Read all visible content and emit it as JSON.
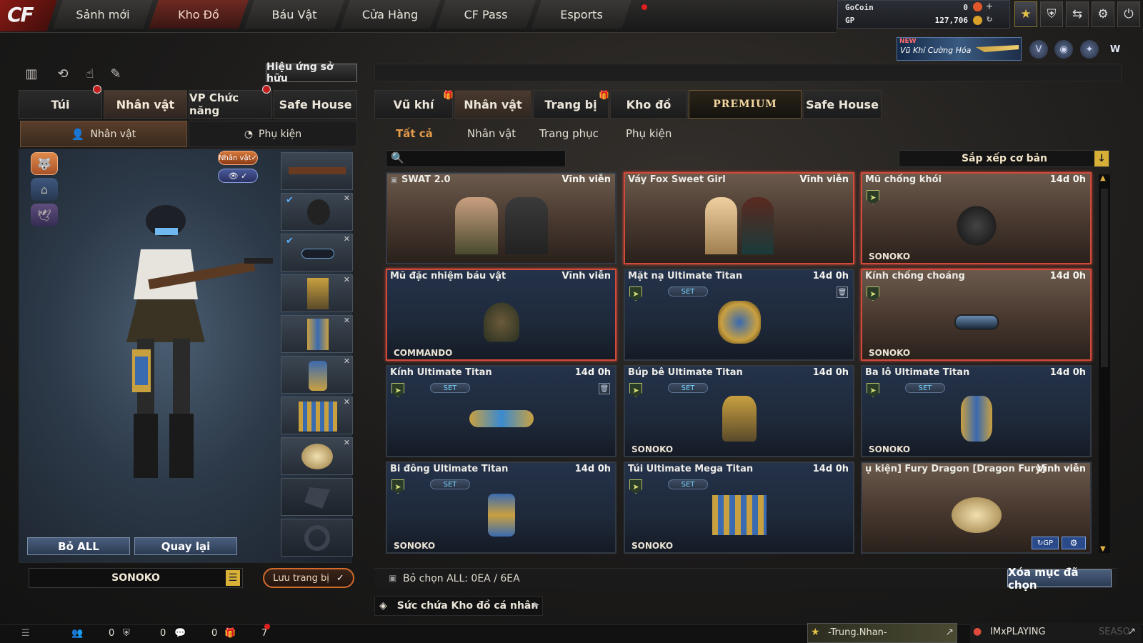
{
  "logo_text": "CF",
  "nav": {
    "tabs": [
      "Sảnh mới",
      "Kho Đồ",
      "Báu Vật",
      "Cửa Hàng",
      "CF Pass",
      "Esports"
    ],
    "active": "Kho Đồ"
  },
  "currency": {
    "gocoin_label": "GoCoin",
    "gocoin_value": "0",
    "gp_label": "GP",
    "gp_value": "127,706"
  },
  "top_icons": [
    "star-icon",
    "shield-icon",
    "exit-icon",
    "gear-icon",
    "power-icon"
  ],
  "banner": {
    "new_label": "NEW",
    "text": "Vũ Khí Cường Hóa"
  },
  "left": {
    "effect_button": "Hiệu ứng sở hữu",
    "tabs": [
      "Túi",
      "Nhân vật",
      "VP Chức năng",
      "Safe House"
    ],
    "active_tab": "Nhân vật",
    "subtabs": [
      "Nhân vật",
      "Phụ kiện"
    ],
    "active_subtab": "Nhân vật",
    "char_toggle": "Nhân vật",
    "btn_remove_all": "Bỏ ALL",
    "btn_back": "Quay lại",
    "character_name": "SONOKO",
    "save_button": "Lưu trang bị"
  },
  "right": {
    "tabs": [
      "Vũ khí",
      "Nhân vật",
      "Trang bị",
      "Kho đồ",
      "PREMIUM",
      "Safe House"
    ],
    "active_tab": "Nhân vật",
    "subtabs": [
      "Tất cả",
      "Nhân vật",
      "Trang phục",
      "Phụ kiện"
    ],
    "active_subtab": "Tất cả",
    "sort_label": "Sắp xếp cơ bản",
    "items": [
      {
        "name": "SWAT 2.0",
        "duration": "Vĩnh viễn",
        "owner": "",
        "set": false
      },
      {
        "name": "Váy Fox Sweet Girl",
        "duration": "Vĩnh viễn",
        "owner": "",
        "set": false
      },
      {
        "name": "Mũ chống khói",
        "duration": "14d 0h",
        "owner": "SONOKO",
        "set": false
      },
      {
        "name": "Mũ đặc nhiệm báu vật",
        "duration": "Vĩnh viễn",
        "owner": "COMMANDO",
        "set": false
      },
      {
        "name": "Mặt nạ Ultimate Titan",
        "duration": "14d 0h",
        "owner": "",
        "set": true
      },
      {
        "name": "Kính chống choáng",
        "duration": "14d 0h",
        "owner": "SONOKO",
        "set": false
      },
      {
        "name": "Kính Ultimate Titan",
        "duration": "14d 0h",
        "owner": "",
        "set": true
      },
      {
        "name": "Búp bê Ultimate Titan",
        "duration": "14d 0h",
        "owner": "SONOKO",
        "set": true
      },
      {
        "name": "Ba lô Ultimate Titan",
        "duration": "14d 0h",
        "owner": "SONOKO",
        "set": true
      },
      {
        "name": "Bi đông Ultimate Titan",
        "duration": "14d 0h",
        "owner": "SONOKO",
        "set": true
      },
      {
        "name": "Túi Ultimate Mega Titan",
        "duration": "14d 0h",
        "owner": "SONOKO",
        "set": true
      },
      {
        "name": "ụ kiện] Fury Dragon [Dragon Fury]",
        "duration": "Vĩnh viễn",
        "owner": "",
        "set": false
      }
    ],
    "set_label": "SET",
    "selection_info": "Bỏ chọn ALL: 0EA / 6EA",
    "delete_button": "Xóa mục đã chọn",
    "capacity_label": "Sức chứa Kho đồ cá nhân"
  },
  "status": {
    "friends": "0",
    "clan": "0",
    "chat": "0",
    "gifts": "7",
    "player_name": "-Trung.Nhan-",
    "playing": "IMxPLAYING",
    "season": "SEASO"
  }
}
